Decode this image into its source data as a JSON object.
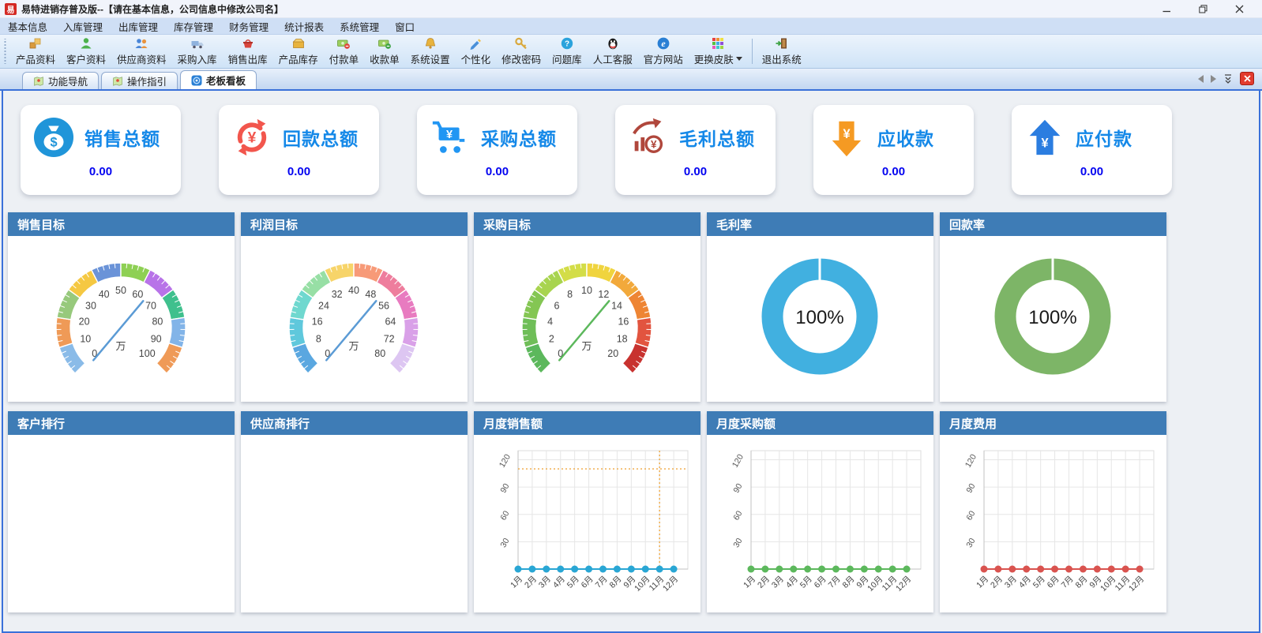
{
  "window": {
    "app_icon_text": "易",
    "title": "易特进销存普及版--【请在基本信息，公司信息中修改公司名】"
  },
  "menubar": {
    "items": [
      "基本信息",
      "入库管理",
      "出库管理",
      "库存管理",
      "财务管理",
      "统计报表",
      "系统管理",
      "窗口"
    ]
  },
  "toolbar": {
    "items": [
      {
        "label": "产品资料",
        "icon": "product-data-icon"
      },
      {
        "label": "客户资料",
        "icon": "customer-data-icon"
      },
      {
        "label": "供应商资料",
        "icon": "supplier-data-icon"
      },
      {
        "label": "采购入库",
        "icon": "purchase-in-icon"
      },
      {
        "label": "销售出库",
        "icon": "sales-out-icon"
      },
      {
        "label": "产品库存",
        "icon": "product-stock-icon"
      },
      {
        "label": "付款单",
        "icon": "payment-slip-icon"
      },
      {
        "label": "收款单",
        "icon": "receipt-slip-icon"
      },
      {
        "label": "系统设置",
        "icon": "system-settings-icon"
      },
      {
        "label": "个性化",
        "icon": "personalize-icon"
      },
      {
        "label": "修改密码",
        "icon": "change-password-icon"
      },
      {
        "label": "问题库",
        "icon": "faq-icon"
      },
      {
        "label": "人工客服",
        "icon": "support-icon"
      },
      {
        "label": "官方网站",
        "icon": "website-icon"
      },
      {
        "label": "更换皮肤",
        "icon": "change-skin-icon",
        "has_dropdown": true
      },
      {
        "label": "退出系统",
        "icon": "exit-icon"
      }
    ]
  },
  "tabs": {
    "items": [
      {
        "label": "功能导航",
        "icon": "map-icon",
        "active": false
      },
      {
        "label": "操作指引",
        "icon": "map-icon",
        "active": false
      },
      {
        "label": "老板看板",
        "icon": "dashboard-icon",
        "active": true
      }
    ]
  },
  "cards": [
    {
      "title": "销售总额",
      "value": "0.00",
      "icon": "money-bag-icon",
      "color": "#2095d9"
    },
    {
      "title": "回款总额",
      "value": "0.00",
      "icon": "refresh-yen-icon",
      "color": "#f2564d"
    },
    {
      "title": "采购总额",
      "value": "0.00",
      "icon": "cart-yen-icon",
      "color": "#2196f3"
    },
    {
      "title": "毛利总额",
      "value": "0.00",
      "icon": "profit-trend-icon",
      "color": "#b0473c"
    },
    {
      "title": "应收款",
      "value": "0.00",
      "icon": "receivable-arrow-icon",
      "color": "#f59a23"
    },
    {
      "title": "应付款",
      "value": "0.00",
      "icon": "payable-arrow-icon",
      "color": "#2b7de0"
    }
  ],
  "chart_data": [
    {
      "panel": "销售目标",
      "type": "gauge",
      "min": 0,
      "max": 100,
      "step": 10,
      "unit": "万",
      "value": 0,
      "needle_color": "#5b9bd5",
      "segment_colors": [
        "#8abbe8",
        "#ef9a57",
        "#97c97c",
        "#f5c842",
        "#6a93d8",
        "#8ed054",
        "#b873e8",
        "#3fc08d",
        "#82b4e8",
        "#ef9a57"
      ]
    },
    {
      "panel": "利润目标",
      "type": "gauge",
      "min": 0,
      "max": 80,
      "step": 8,
      "unit": "万",
      "value": 0,
      "needle_color": "#5b9bd5",
      "segment_colors": [
        "#5aa7e0",
        "#5fc8dc",
        "#6fd8cf",
        "#97dfa5",
        "#f7d469",
        "#f79a78",
        "#ee7d9d",
        "#e87bc0",
        "#d9a0e8",
        "#ddc6f2"
      ]
    },
    {
      "panel": "采购目标",
      "type": "gauge",
      "min": 0,
      "max": 20,
      "step": 2,
      "unit": "万",
      "value": 0,
      "needle_color": "#5cb85c",
      "segment_colors": [
        "#5cb85c",
        "#6fbe58",
        "#84c653",
        "#a8d44f",
        "#d3dd47",
        "#f0d43e",
        "#f2a93b",
        "#ee8534",
        "#e2543f",
        "#c8322f"
      ]
    },
    {
      "panel": "毛利率",
      "type": "donut",
      "value": 100,
      "label": "100%",
      "color": "#41b0e0"
    },
    {
      "panel": "回款率",
      "type": "donut",
      "value": 100,
      "label": "100%",
      "color": "#7db567"
    },
    {
      "panel": "客户排行",
      "type": "empty"
    },
    {
      "panel": "供应商排行",
      "type": "empty"
    },
    {
      "panel": "月度销售额",
      "type": "line",
      "categories": [
        "1月",
        "2月",
        "3月",
        "4月",
        "5月",
        "6月",
        "7月",
        "8月",
        "9月",
        "10月",
        "11月",
        "12月"
      ],
      "values": [
        0,
        0,
        0,
        0,
        0,
        0,
        0,
        0,
        0,
        0,
        0,
        0
      ],
      "ylim": [
        0,
        130
      ],
      "yticks": [
        30,
        60,
        90,
        120
      ],
      "color": "#29a6d4",
      "crosshair": {
        "month_index": 10,
        "y_value": 110,
        "color": "#f0a840"
      }
    },
    {
      "panel": "月度采购额",
      "type": "line",
      "categories": [
        "1月",
        "2月",
        "3月",
        "4月",
        "5月",
        "6月",
        "7月",
        "8月",
        "9月",
        "10月",
        "11月",
        "12月"
      ],
      "values": [
        0,
        0,
        0,
        0,
        0,
        0,
        0,
        0,
        0,
        0,
        0,
        0
      ],
      "ylim": [
        0,
        130
      ],
      "yticks": [
        30,
        60,
        90,
        120
      ],
      "color": "#5cb85c"
    },
    {
      "panel": "月度费用",
      "type": "line",
      "categories": [
        "1月",
        "2月",
        "3月",
        "4月",
        "5月",
        "6月",
        "7月",
        "8月",
        "9月",
        "10月",
        "11月",
        "12月"
      ],
      "values": [
        0,
        0,
        0,
        0,
        0,
        0,
        0,
        0,
        0,
        0,
        0,
        0
      ],
      "ylim": [
        0,
        130
      ],
      "yticks": [
        30,
        60,
        90,
        120
      ],
      "color": "#d9534f"
    }
  ]
}
